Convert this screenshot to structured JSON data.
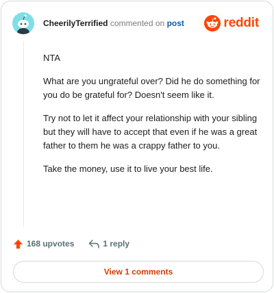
{
  "comment": {
    "username": "CheerilyTerrified",
    "commented_text": "commented on",
    "post_link_text": "post",
    "paragraphs": [
      "NTA",
      "What are you ungrateful over? Did he do something for you do be grateful for? Doesn't seem like it.",
      "Try not to let it affect your relationship with your sibling but they will have to accept that even if he was a great father to them he was a crappy father to you.",
      "Take the money, use it to live your best life."
    ]
  },
  "brand": {
    "name": "reddit",
    "color": "#ff4500"
  },
  "actions": {
    "upvotes_label": "168 upvotes",
    "reply_label": "1 reply",
    "upvote_color": "#ff4500"
  },
  "footer": {
    "view_comments_label": "View 1 comments",
    "accent": "#d93a00"
  },
  "icons": {
    "avatar": "snoo-avatar-icon",
    "logo": "reddit-logo-icon",
    "upvote": "upvote-arrow-icon",
    "reply": "reply-arrow-icon"
  }
}
